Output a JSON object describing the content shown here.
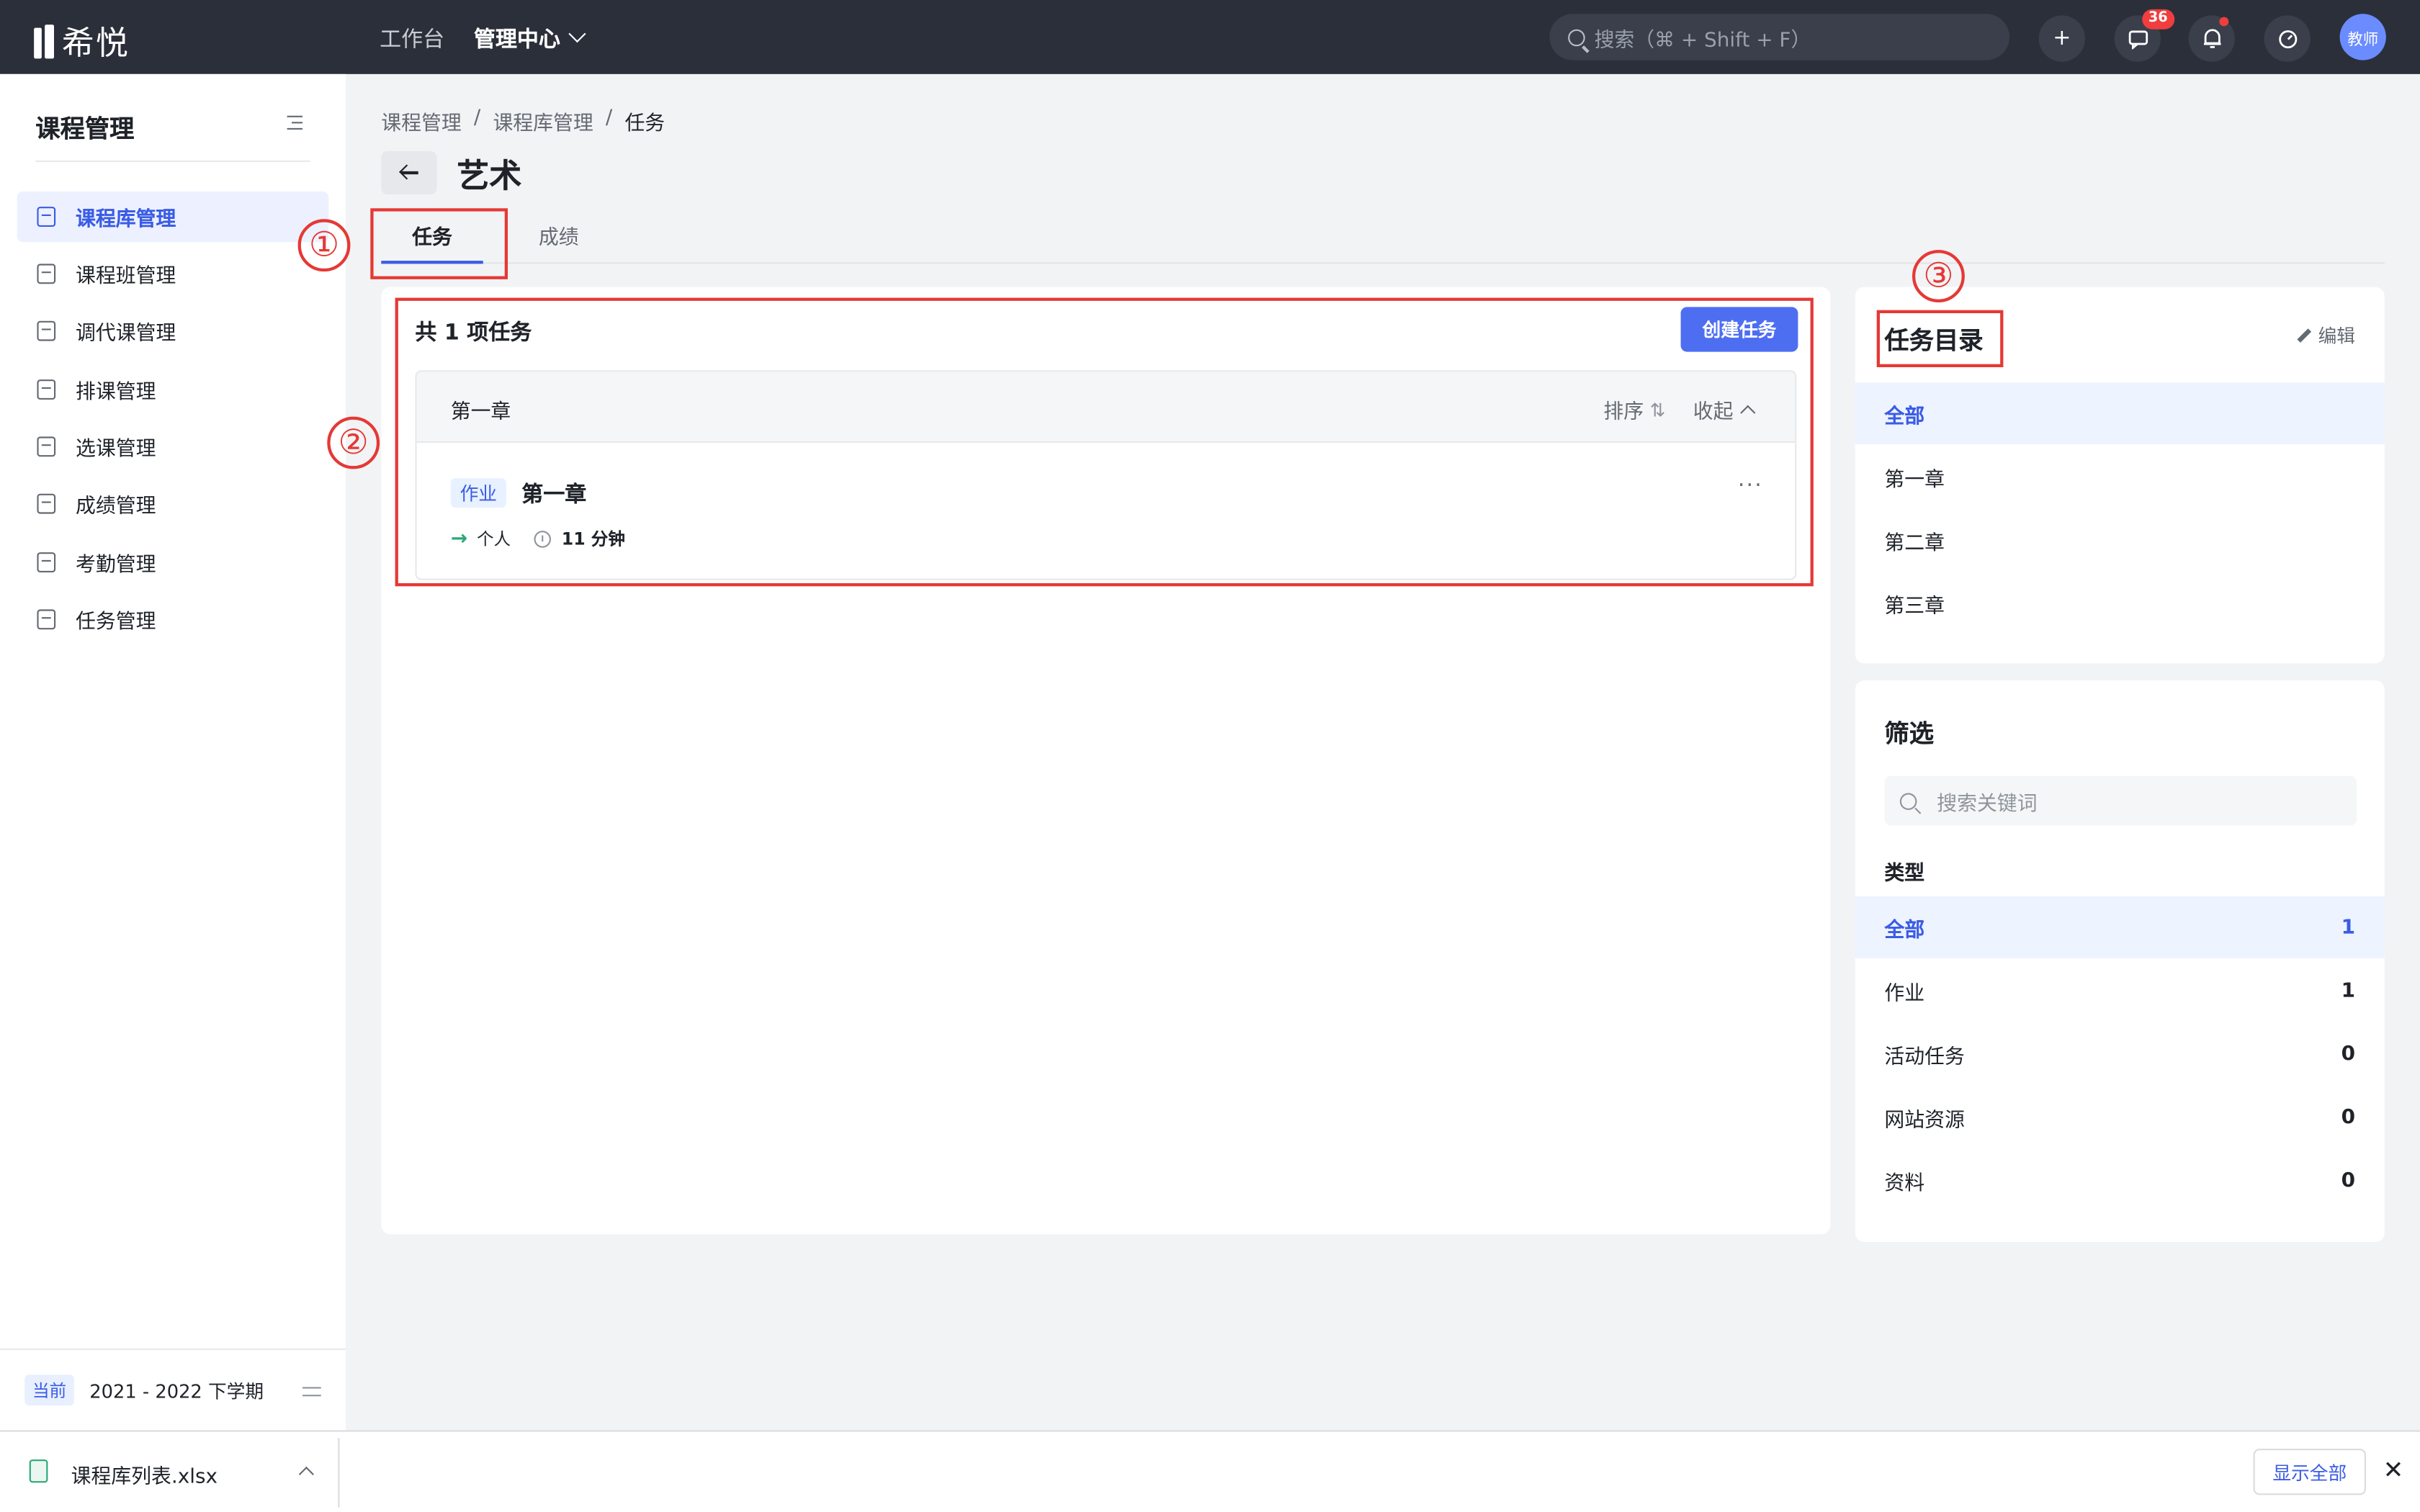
{
  "topbar": {
    "logo_text": "希悦",
    "nav": [
      "工作台",
      "管理中心"
    ],
    "search_placeholder": "搜索（⌘ + Shift + F）",
    "plus": "+",
    "message_badge": "36",
    "avatar": "教师"
  },
  "sidebar": {
    "title": "课程管理",
    "items": [
      {
        "label": "课程库管理",
        "icon": "library-icon",
        "active": true
      },
      {
        "label": "课程班管理",
        "icon": "class-icon",
        "active": false
      },
      {
        "label": "调代课管理",
        "icon": "substitute-icon",
        "active": false
      },
      {
        "label": "排课管理",
        "icon": "schedule-icon",
        "active": false
      },
      {
        "label": "选课管理",
        "icon": "selection-icon",
        "active": false
      },
      {
        "label": "成绩管理",
        "icon": "grade-icon",
        "active": false
      },
      {
        "label": "考勤管理",
        "icon": "attendance-icon",
        "active": false
      },
      {
        "label": "任务管理",
        "icon": "task-list-icon",
        "active": false
      }
    ],
    "term_tag": "当前",
    "term": "2021 - 2022 下学期"
  },
  "breadcrumb": [
    "课程管理",
    "/",
    "课程库管理",
    "/",
    "任务"
  ],
  "page": {
    "title": "艺术",
    "tabs": [
      "任务",
      "成绩"
    ]
  },
  "task_panel": {
    "summary": "共 1 项任务",
    "create_button": "创建任务",
    "chapter": {
      "name": "第一章",
      "sort_label": "排序",
      "sort_icon": "⇅",
      "collapse_label": "收起",
      "task": {
        "tag": "作业",
        "name": "第一章",
        "more": "···",
        "assignee": "个人",
        "duration": "11 分钟"
      }
    }
  },
  "directory": {
    "title": "任务目录",
    "edit": "编辑",
    "items": [
      {
        "label": "全部",
        "active": true
      },
      {
        "label": "第一章",
        "active": false
      },
      {
        "label": "第二章",
        "active": false
      },
      {
        "label": "第三章",
        "active": false
      }
    ]
  },
  "filter": {
    "title": "筛选",
    "search_placeholder": "搜索关键词",
    "type_label": "类型",
    "types": [
      {
        "label": "全部",
        "count": "1",
        "active": true
      },
      {
        "label": "作业",
        "count": "1",
        "active": false
      },
      {
        "label": "活动任务",
        "count": "0",
        "active": false
      },
      {
        "label": "网站资源",
        "count": "0",
        "active": false
      },
      {
        "label": "资料",
        "count": "0",
        "active": false
      }
    ]
  },
  "annotations": [
    "①",
    "②",
    "③"
  ],
  "download_bar": {
    "file_name": "课程库列表.xlsx",
    "show_all": "显示全部",
    "close": "✕"
  },
  "colors": {
    "accent": "#3a5ce6",
    "primary_button": "#4e6ef2",
    "topbar": "#2b2f3a",
    "annotation": "#e53935"
  }
}
